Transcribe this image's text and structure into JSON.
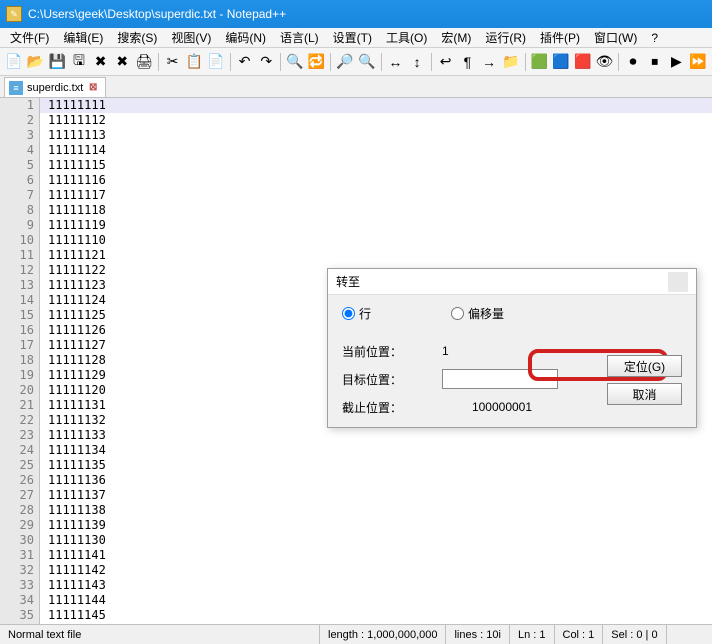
{
  "window": {
    "title": "C:\\Users\\geek\\Desktop\\superdic.txt - Notepad++"
  },
  "menu": {
    "file": "文件(F)",
    "edit": "编辑(E)",
    "search": "搜索(S)",
    "view": "视图(V)",
    "encoding": "编码(N)",
    "language": "语言(L)",
    "settings": "设置(T)",
    "tools": "工具(O)",
    "macro": "宏(M)",
    "run": "运行(R)",
    "plugins": "插件(P)",
    "window": "窗口(W)",
    "help": "?"
  },
  "tab": {
    "name": "superdic.txt"
  },
  "editor": {
    "lines": [
      {
        "n": 1,
        "t": "11111111"
      },
      {
        "n": 2,
        "t": "11111112"
      },
      {
        "n": 3,
        "t": "11111113"
      },
      {
        "n": 4,
        "t": "11111114"
      },
      {
        "n": 5,
        "t": "11111115"
      },
      {
        "n": 6,
        "t": "11111116"
      },
      {
        "n": 7,
        "t": "11111117"
      },
      {
        "n": 8,
        "t": "11111118"
      },
      {
        "n": 9,
        "t": "11111119"
      },
      {
        "n": 10,
        "t": "11111110"
      },
      {
        "n": 11,
        "t": "11111121"
      },
      {
        "n": 12,
        "t": "11111122"
      },
      {
        "n": 13,
        "t": "11111123"
      },
      {
        "n": 14,
        "t": "11111124"
      },
      {
        "n": 15,
        "t": "11111125"
      },
      {
        "n": 16,
        "t": "11111126"
      },
      {
        "n": 17,
        "t": "11111127"
      },
      {
        "n": 18,
        "t": "11111128"
      },
      {
        "n": 19,
        "t": "11111129"
      },
      {
        "n": 20,
        "t": "11111120"
      },
      {
        "n": 21,
        "t": "11111131"
      },
      {
        "n": 22,
        "t": "11111132"
      },
      {
        "n": 23,
        "t": "11111133"
      },
      {
        "n": 24,
        "t": "11111134"
      },
      {
        "n": 25,
        "t": "11111135"
      },
      {
        "n": 26,
        "t": "11111136"
      },
      {
        "n": 27,
        "t": "11111137"
      },
      {
        "n": 28,
        "t": "11111138"
      },
      {
        "n": 29,
        "t": "11111139"
      },
      {
        "n": 30,
        "t": "11111130"
      },
      {
        "n": 31,
        "t": "11111141"
      },
      {
        "n": 32,
        "t": "11111142"
      },
      {
        "n": 33,
        "t": "11111143"
      },
      {
        "n": 34,
        "t": "11111144"
      },
      {
        "n": 35,
        "t": "11111145"
      }
    ]
  },
  "dialog": {
    "title": "转至",
    "radio_line": "行",
    "radio_offset": "偏移量",
    "current_label": "当前位置：",
    "current_val": "1",
    "target_label": "目标位置：",
    "target_val": "",
    "end_label": "截止位置：",
    "end_val": "100000001",
    "go_btn": "定位(G)",
    "cancel_btn": "取消"
  },
  "status": {
    "filetype": "Normal text file",
    "length": "length : 1,000,000,000",
    "lines": "lines : 10i",
    "ln": "Ln : 1",
    "col": "Col : 1",
    "sel": "Sel : 0 | 0"
  },
  "icons": {
    "new": "📄",
    "open": "📂",
    "save": "💾",
    "saveall": "🖫",
    "close": "✖",
    "closeall": "✖",
    "print": "🖨",
    "cut": "✂",
    "copy": "📋",
    "paste": "📄",
    "undo": "↶",
    "redo": "↷",
    "find": "🔍",
    "replace": "🔁",
    "zoomin": "🔎",
    "zoomout": "🔍",
    "sync": "↔",
    "sync2": "↕",
    "wrap": "↩",
    "allchars": "¶",
    "indent": "→",
    "folder": "📁",
    "b1": "🟩",
    "b2": "🟦",
    "b3": "🟥",
    "b4": "👁",
    "rec": "⏺",
    "play": "▶",
    "stop": "⏹",
    "play2": "⏩"
  }
}
